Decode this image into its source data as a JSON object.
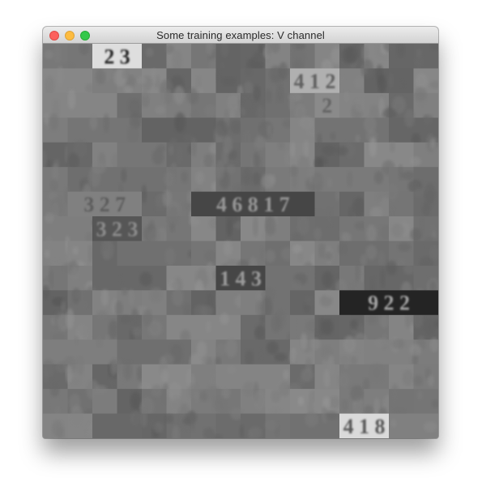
{
  "window": {
    "title": "Some training examples: V channel",
    "controls": [
      "close",
      "minimize",
      "zoom"
    ]
  },
  "samples": [
    {
      "label": "2 3",
      "tone": "light"
    },
    {
      "label": "4 1 2",
      "tone": "light"
    },
    {
      "label": "2",
      "tone": "mid"
    },
    {
      "label": "3 2 7",
      "tone": "mid"
    },
    {
      "label": "4 6 8 1 7",
      "tone": "dark"
    },
    {
      "label": "3 2 3",
      "tone": "dark"
    },
    {
      "label": "1 4 3",
      "tone": "dark"
    },
    {
      "label": "9 2 2",
      "tone": "dark"
    },
    {
      "label": "4 1 8",
      "tone": "light"
    }
  ]
}
